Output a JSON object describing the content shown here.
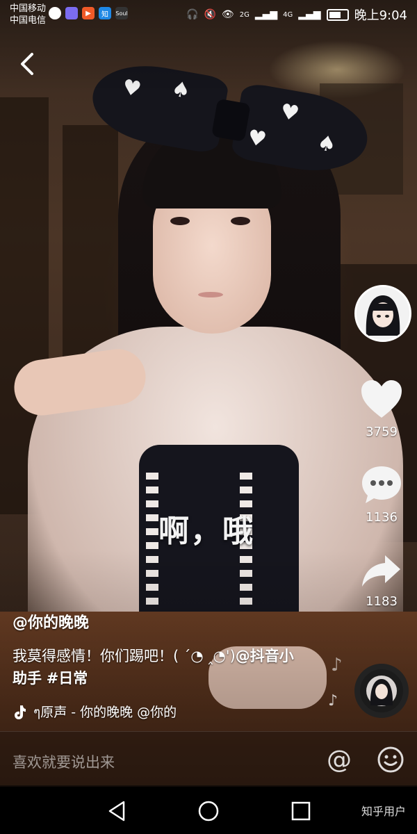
{
  "status_bar": {
    "carrier_1": "中国移动",
    "carrier_2": "中国电信",
    "time": "晚上9:04",
    "network_1": "2G",
    "network_2": "4G",
    "app_icons": [
      "video-icon",
      "app-icon",
      "play-icon",
      "zhihu-icon",
      "soul-icon"
    ],
    "app_zhihu_label": "知",
    "app_soul_label": "Soul"
  },
  "video": {
    "subtitle": "啊，哦"
  },
  "actions": {
    "likes": "3759",
    "comments": "1136",
    "shares": "1183"
  },
  "post": {
    "author": "@你的晚晚",
    "description": "我莫得感情！你们踢吧！( ´◔ ‸◔')",
    "mention": "@抖音小助手",
    "hashtag": "#日常",
    "music": "ๆ原声 - 你的晚晚   @你的"
  },
  "comment_bar": {
    "placeholder": "喜欢就要说出来",
    "at_symbol": "@"
  },
  "nav": {
    "watermark": "知乎用户"
  },
  "colors": {
    "accent": "#ffffff",
    "comment_placeholder": "#a09890"
  }
}
